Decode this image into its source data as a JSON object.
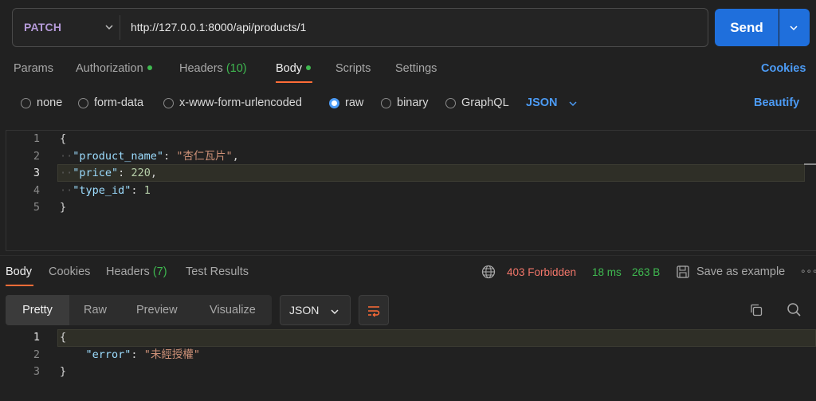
{
  "request": {
    "method": "PATCH",
    "url": "http://127.0.0.1:8000/api/products/1",
    "send_label": "Send"
  },
  "request_tabs": {
    "params": "Params",
    "authorization": "Authorization",
    "headers": "Headers",
    "headers_count": "(10)",
    "body": "Body",
    "scripts": "Scripts",
    "settings": "Settings",
    "cookies": "Cookies"
  },
  "body_types": {
    "none": "none",
    "form_data": "form-data",
    "urlencoded": "x-www-form-urlencoded",
    "raw": "raw",
    "binary": "binary",
    "graphql": "GraphQL",
    "format": "JSON",
    "beautify": "Beautify",
    "selected": "raw"
  },
  "request_body": {
    "line_numbers": [
      "1",
      "2",
      "3",
      "4",
      "5"
    ],
    "open_brace": "{",
    "close_brace": "}",
    "fields": [
      {
        "key": "\"product_name\"",
        "value": "\"杏仁瓦片\"",
        "trail": ","
      },
      {
        "key": "\"price\"",
        "value": "220",
        "trail": ","
      },
      {
        "key": "\"type_id\"",
        "value": "1",
        "trail": ""
      }
    ]
  },
  "response_tabs": {
    "body": "Body",
    "cookies": "Cookies",
    "headers": "Headers",
    "headers_count": "(7)",
    "test_results": "Test Results"
  },
  "response_meta": {
    "status": "403 Forbidden",
    "time": "18 ms",
    "size": "263 B",
    "save_example": "Save as example",
    "more": "∘∘∘"
  },
  "response_view": {
    "pretty": "Pretty",
    "raw": "Raw",
    "preview": "Preview",
    "visualize": "Visualize",
    "format": "JSON"
  },
  "response_body": {
    "line_numbers": [
      "1",
      "2",
      "3"
    ],
    "open_brace": "{",
    "close_brace": "}",
    "key": "\"error\"",
    "value": "\"未經授權\""
  },
  "colors": {
    "accent": "#1f6fdc",
    "link": "#4c9bf5",
    "active_tab": "#ff6c37",
    "success": "#3fb950",
    "error": "#f2766a",
    "method": "#b59ad8"
  }
}
